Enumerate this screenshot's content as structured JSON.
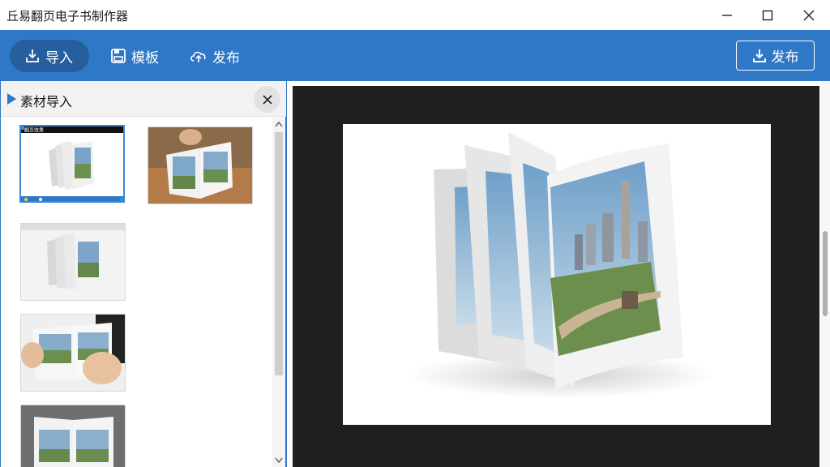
{
  "window": {
    "title": "丘易翻页电子书制作器",
    "minimize_icon": "minimize-icon",
    "maximize_icon": "maximize-icon",
    "close_icon": "close-icon"
  },
  "toolbar": {
    "import_label": "导入",
    "template_label": "模板",
    "publish_label": "发布",
    "publish_button_label": "发布",
    "accent_color": "#2f78c8"
  },
  "panel": {
    "title": "素材导入",
    "close_icon": "close-icon",
    "thumbnails": [
      {
        "label": "thumbnail-1",
        "selected": true,
        "caption": "翻页效果"
      },
      {
        "label": "thumbnail-2",
        "selected": false
      },
      {
        "label": "thumbnail-3",
        "selected": false
      },
      {
        "label": "thumbnail-4",
        "selected": false
      },
      {
        "label": "thumbnail-5",
        "selected": false
      }
    ]
  },
  "preview": {
    "background": "#1f1f1f"
  }
}
